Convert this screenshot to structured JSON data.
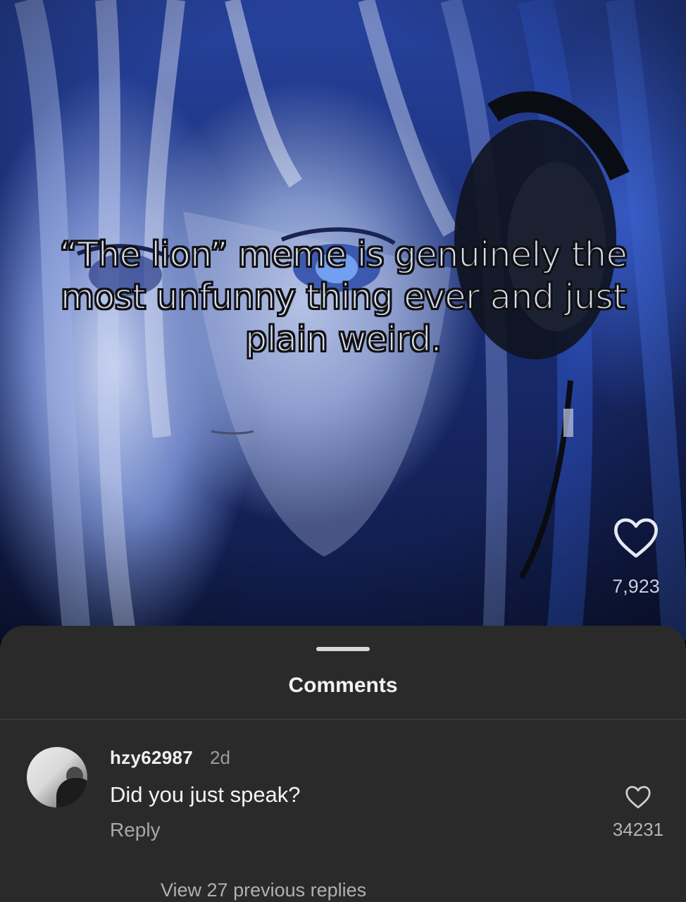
{
  "post": {
    "caption": "“The lion” meme is genuinely the most unfunny thing ever and just plain weird.",
    "likes": "7,923",
    "like_icon": "heart-outline-icon"
  },
  "comments_sheet": {
    "title": "Comments",
    "comments": [
      {
        "username": "hzy62987",
        "time": "2d",
        "text": "Did you just speak?",
        "reply_label": "Reply",
        "likes": "34231",
        "like_icon": "heart-outline-icon",
        "view_replies_label": "View 27 previous replies"
      }
    ]
  },
  "colors": {
    "sheet_background": "#2a2a2a",
    "post_accent": "#27439e"
  }
}
